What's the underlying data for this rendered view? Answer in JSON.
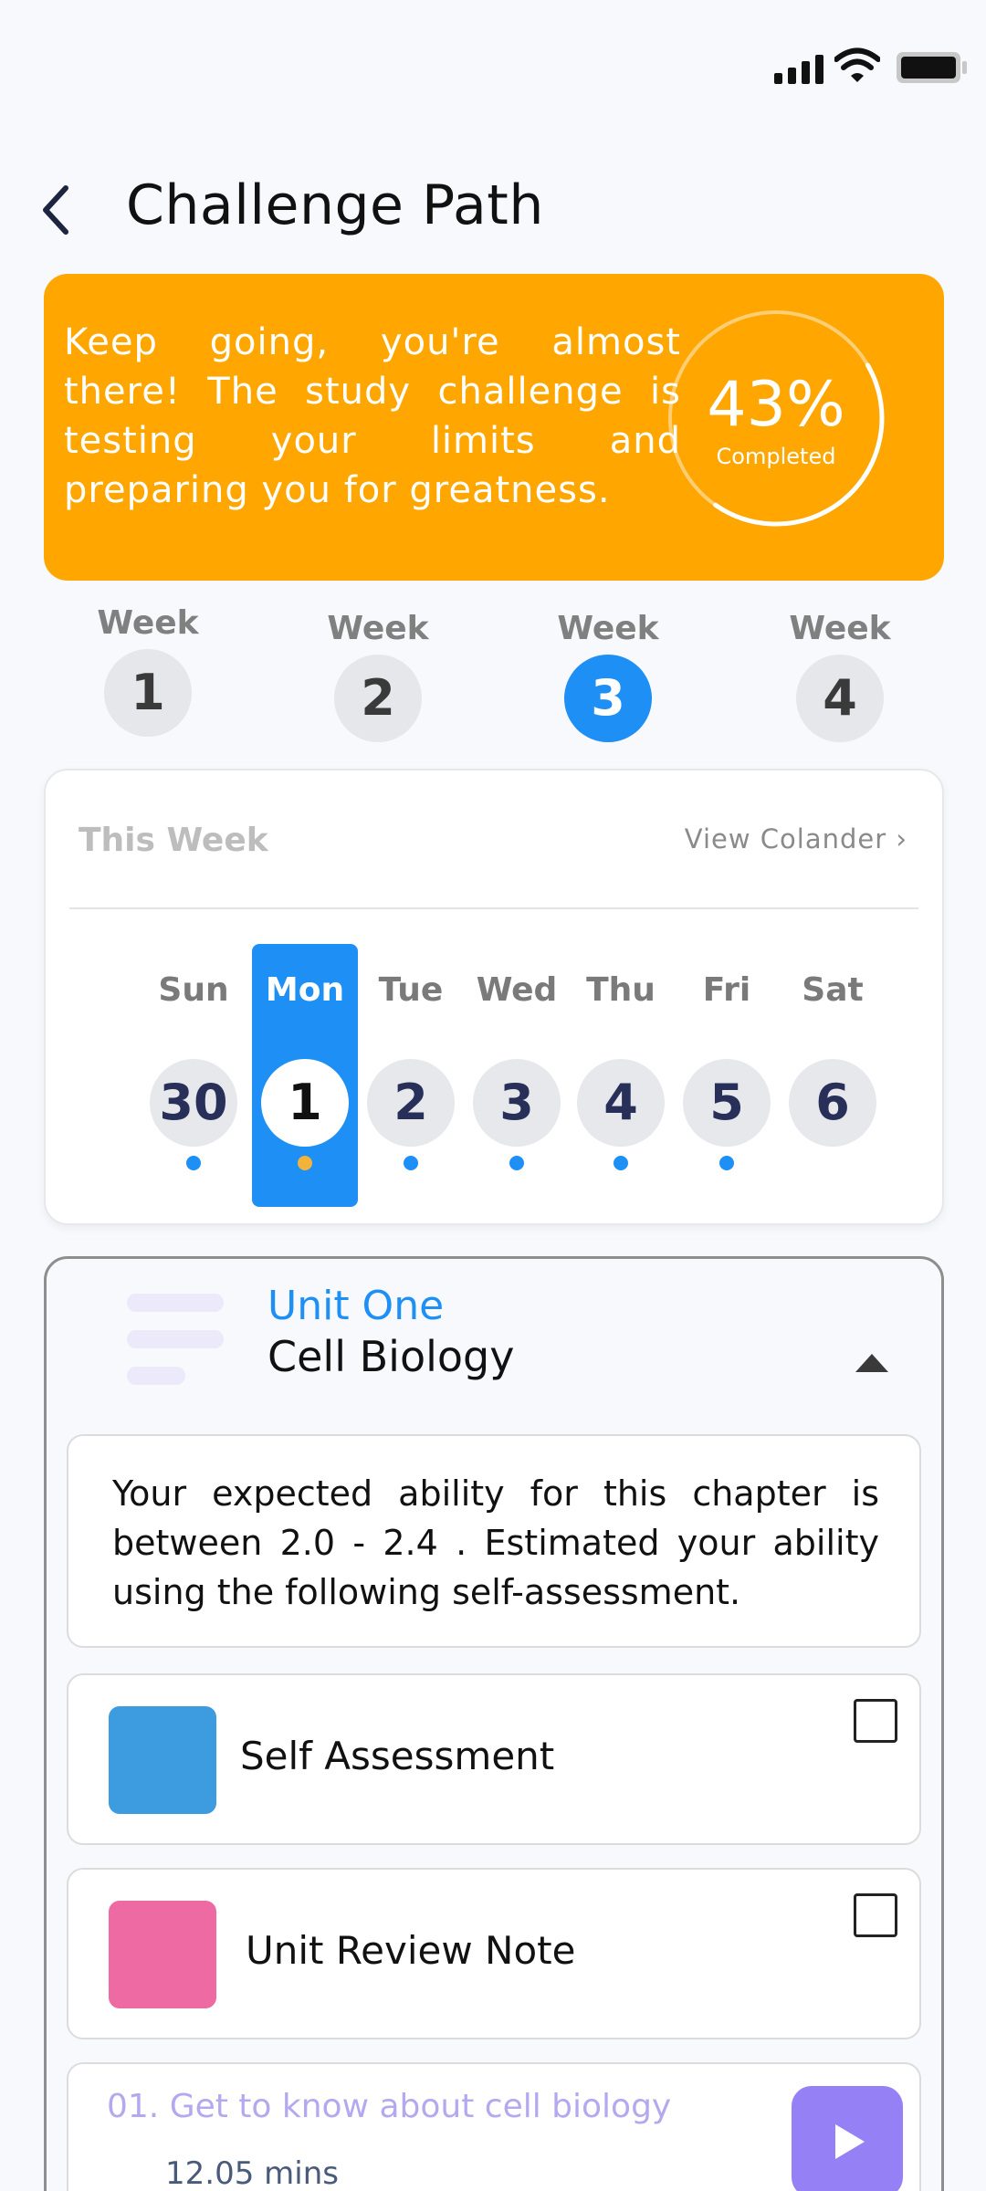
{
  "header": {
    "title": "Challenge Path"
  },
  "banner": {
    "message": "Keep going, you're almost there! The study challenge is testing your limits and preparing you for greatness.",
    "progress_value": "43%",
    "progress_fraction": 0.43,
    "progress_label": "Completed",
    "color": "#ffa600"
  },
  "weeks": [
    {
      "label": "Week",
      "number": "1"
    },
    {
      "label": "Week",
      "number": "2"
    },
    {
      "label": "Week",
      "number": "3",
      "active": true
    },
    {
      "label": "Week",
      "number": "4"
    }
  ],
  "this_week": {
    "title": "This Week",
    "view_calendar": "View  Colander ›",
    "days": [
      {
        "name": "Sun",
        "date": "30"
      },
      {
        "name": "Mon",
        "date": "1",
        "active": true
      },
      {
        "name": "Tue",
        "date": "2"
      },
      {
        "name": "Wed",
        "date": "3"
      },
      {
        "name": "Thu",
        "date": "4"
      },
      {
        "name": "Fri",
        "date": "5"
      },
      {
        "name": "Sat",
        "date": "6"
      }
    ]
  },
  "unit": {
    "label": "Unit One",
    "title": "Cell Biology",
    "info": " Your expected ability for this chapter is between 2.0 - 2.4 . Estimated your ability using the following self-assessment.",
    "tasks": [
      {
        "label": "Self Assessment",
        "color": "#3d9be0",
        "checked": false
      },
      {
        "label": "Unit Review Note",
        "color": "#ee6aa2",
        "checked": false
      }
    ],
    "lesson": {
      "title": "01. Get to know about cell biology",
      "duration": "12.05 mins"
    }
  },
  "colors": {
    "accent": "#1e8ff5",
    "play": "#9580f5"
  }
}
